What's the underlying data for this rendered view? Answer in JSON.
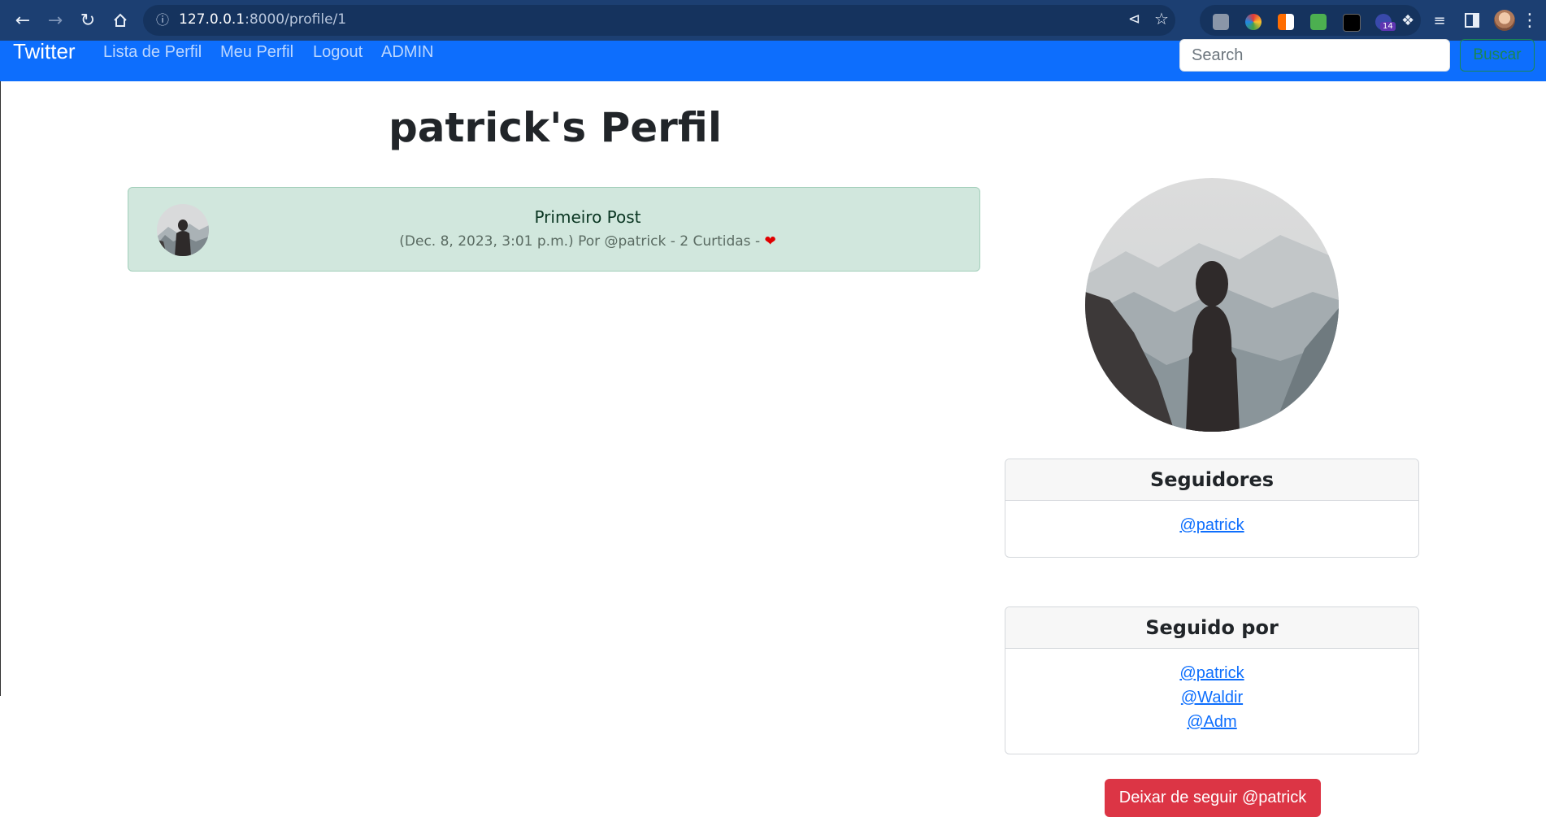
{
  "browser": {
    "url_host": "127.0.0.1",
    "url_path": ":8000/profile/1",
    "extension_badge": "14"
  },
  "navbar": {
    "brand": "Twitter",
    "links": [
      "Lista de Perfil",
      "Meu Perfil",
      "Logout",
      "ADMIN"
    ],
    "search_placeholder": "Search",
    "search_button": "Buscar"
  },
  "page": {
    "title": "patrick's Perfil"
  },
  "post": {
    "title": "Primeiro Post",
    "meta": "(Dec. 8, 2023, 3:01 p.m.) Por @patrick - 2 Curtidas -"
  },
  "seguidores": {
    "header": "Seguidores",
    "users": [
      "@patrick"
    ]
  },
  "seguido_por": {
    "header": "Seguido por",
    "users": [
      "@patrick",
      "@Waldir",
      "@Adm"
    ]
  },
  "unfollow_button": "Deixar de seguir @patrick",
  "colors": {
    "navbar": "#0d6efd",
    "post_bg": "#d1e7dd",
    "danger": "#dc3545",
    "success": "#198754",
    "chrome": "#1c3f72"
  }
}
